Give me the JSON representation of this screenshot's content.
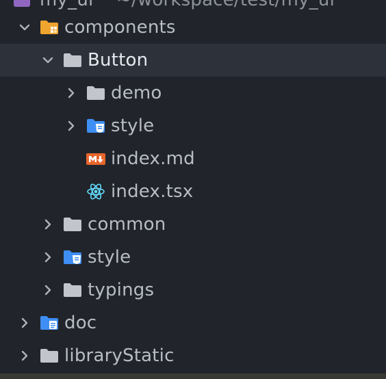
{
  "tree": {
    "root": {
      "label": "my_ui",
      "path": "~/workspace/test/my_ui"
    },
    "items": [
      {
        "label": "components",
        "depth": 0,
        "expanded": true,
        "icon": "components-folder-icon"
      },
      {
        "label": "Button",
        "depth": 1,
        "expanded": true,
        "selected": true,
        "icon": "folder-icon"
      },
      {
        "label": "demo",
        "depth": 2,
        "expanded": false,
        "icon": "folder-icon"
      },
      {
        "label": "style",
        "depth": 2,
        "expanded": false,
        "icon": "css-folder-icon"
      },
      {
        "label": "index.md",
        "depth": 2,
        "file": true,
        "icon": "markdown-icon"
      },
      {
        "label": "index.tsx",
        "depth": 2,
        "file": true,
        "icon": "react-icon"
      },
      {
        "label": "common",
        "depth": 1,
        "expanded": false,
        "icon": "folder-icon"
      },
      {
        "label": "style",
        "depth": 1,
        "expanded": false,
        "icon": "css-folder-icon"
      },
      {
        "label": "typings",
        "depth": 1,
        "expanded": false,
        "icon": "folder-icon"
      },
      {
        "label": "doc",
        "depth": 0,
        "expanded": false,
        "icon": "doc-folder-icon"
      },
      {
        "label": "libraryStatic",
        "depth": 0,
        "expanded": false,
        "icon": "folder-icon"
      }
    ]
  },
  "colors": {
    "background": "#21252b",
    "selected_row": "#2c313a",
    "folder": "#c2c6cc",
    "components_folder": "#f0a52f",
    "css_folder": "#3f8ef4",
    "markdown": "#e8652b",
    "react": "#61dafb",
    "chevron": "#aeb3bb"
  }
}
